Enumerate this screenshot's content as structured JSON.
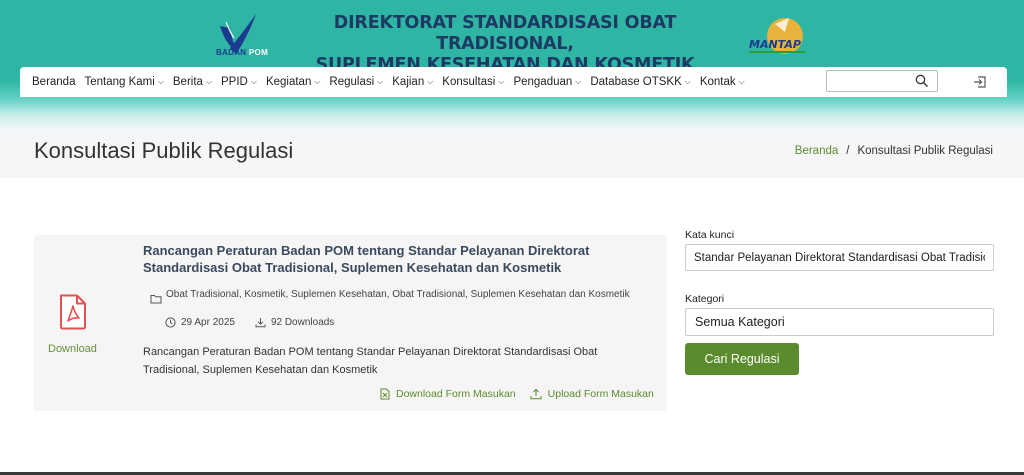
{
  "header": {
    "logo_left_primary": "BADAN",
    "logo_left_secondary": "POM",
    "title_line1": "DIREKTORAT STANDARDISASI OBAT TRADISIONAL,",
    "title_line2": "SUPLEMEN KESEHATAN DAN KOSMETIK",
    "logo_right_text": "MANTAP"
  },
  "nav": {
    "items": [
      {
        "label": "Beranda",
        "dropdown": false
      },
      {
        "label": "Tentang Kami",
        "dropdown": true
      },
      {
        "label": "Berita",
        "dropdown": true
      },
      {
        "label": "PPID",
        "dropdown": true
      },
      {
        "label": "Kegiatan",
        "dropdown": true
      },
      {
        "label": "Regulasi",
        "dropdown": true
      },
      {
        "label": "Kajian",
        "dropdown": true
      },
      {
        "label": "Konsultasi",
        "dropdown": true
      },
      {
        "label": "Pengaduan",
        "dropdown": true
      },
      {
        "label": "Database OTSKK",
        "dropdown": true
      },
      {
        "label": "Kontak",
        "dropdown": true
      }
    ],
    "chevron": "⌵",
    "search_value": ""
  },
  "page": {
    "title": "Konsultasi Publik Regulasi",
    "breadcrumb_home": "Beranda",
    "breadcrumb_sep": "/",
    "breadcrumb_current": "Konsultasi Publik Regulasi"
  },
  "result": {
    "download_label": "Download",
    "title": "Rancangan Peraturan Badan POM tentang Standar Pelayanan Direktorat Standardisasi Obat Tradisional, Suplemen Kesehatan dan Kosmetik",
    "categories": "Obat Tradisional, Kosmetik, Suplemen Kesehatan, Obat Tradisional, Suplemen Kesehatan dan Kosmetik",
    "date": "29 Apr 2025",
    "downloads": "92 Downloads",
    "description": "Rancangan Peraturan Badan POM tentang Standar Pelayanan Direktorat Standardisasi Obat Tradisional, Suplemen Kesehatan dan Kosmetik",
    "action_download_form": "Download Form Masukan",
    "action_upload_form": "Upload Form Masukan"
  },
  "filter": {
    "keyword_label": "Kata kunci",
    "keyword_value": "Standar Pelayanan Direktorat Standardisasi Obat Tradisional",
    "category_label": "Kategori",
    "category_value": "Semua Kategori",
    "submit_label": "Cari Regulasi"
  },
  "colors": {
    "header_teal": "#2fb5a3",
    "title_navy": "#1c3a63",
    "accent_green": "#5a8c2e",
    "pdf_red": "#e05252"
  }
}
